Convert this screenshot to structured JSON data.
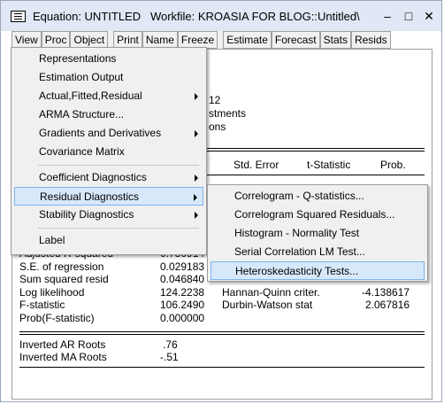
{
  "window": {
    "title": "Equation: UNTITLED   Workfile: KROASIA FOR BLOG::Untitled\\",
    "minimize": "–",
    "maximize": "□",
    "close": "✕"
  },
  "toolbar": {
    "view": "View",
    "proc": "Proc",
    "object": "Object",
    "print": "Print",
    "name": "Name",
    "freeze": "Freeze",
    "estimate": "Estimate",
    "forecast": "Forecast",
    "stats": "Stats",
    "resids": "Resids"
  },
  "output": {
    "partial_line1": "12",
    "partial_line2": "stments",
    "partial_line3": "ons",
    "col_stderr": "Std. Error",
    "col_tstat": "t-Statistic",
    "col_prob": "Prob.",
    "rows_left": [
      {
        "label": "Adjusted R-squared",
        "value": "0.780914"
      },
      {
        "label": "S.E. of regression",
        "value": "0.029183"
      },
      {
        "label": "Sum squared resid",
        "value": "0.046840"
      },
      {
        "label": "Log likelihood",
        "value": "124.2238"
      },
      {
        "label": "F-statistic",
        "value": "106.2490"
      },
      {
        "label": "Prob(F-statistic)",
        "value": "0.000000"
      }
    ],
    "rows_right": [
      {
        "label": "Hannan-Quinn criter.",
        "value": "-4.138617"
      },
      {
        "label": "Durbin-Watson stat",
        "value": "2.067816"
      }
    ],
    "roots": [
      {
        "label": "Inverted AR Roots",
        "value": ".76"
      },
      {
        "label": "Inverted MA Roots",
        "value": "-.51"
      }
    ]
  },
  "menu": {
    "items": [
      {
        "label": "Representations",
        "submenu": false
      },
      {
        "label": "Estimation Output",
        "submenu": false
      },
      {
        "label": "Actual,Fitted,Residual",
        "submenu": true
      },
      {
        "label": "ARMA Structure...",
        "submenu": false
      },
      {
        "label": "Gradients and Derivatives",
        "submenu": true
      },
      {
        "label": "Covariance Matrix",
        "submenu": false
      },
      {
        "label": "Coefficient Diagnostics",
        "submenu": true
      },
      {
        "label": "Residual Diagnostics",
        "submenu": true
      },
      {
        "label": "Stability Diagnostics",
        "submenu": true
      },
      {
        "label": "Label",
        "submenu": false
      }
    ]
  },
  "submenu": {
    "items": [
      {
        "label": "Correlogram - Q-statistics..."
      },
      {
        "label": "Correlogram Squared Residuals..."
      },
      {
        "label": "Histogram - Normality Test"
      },
      {
        "label": "Serial Correlation LM Test..."
      },
      {
        "label": "Heteroskedasticity Tests..."
      }
    ]
  }
}
